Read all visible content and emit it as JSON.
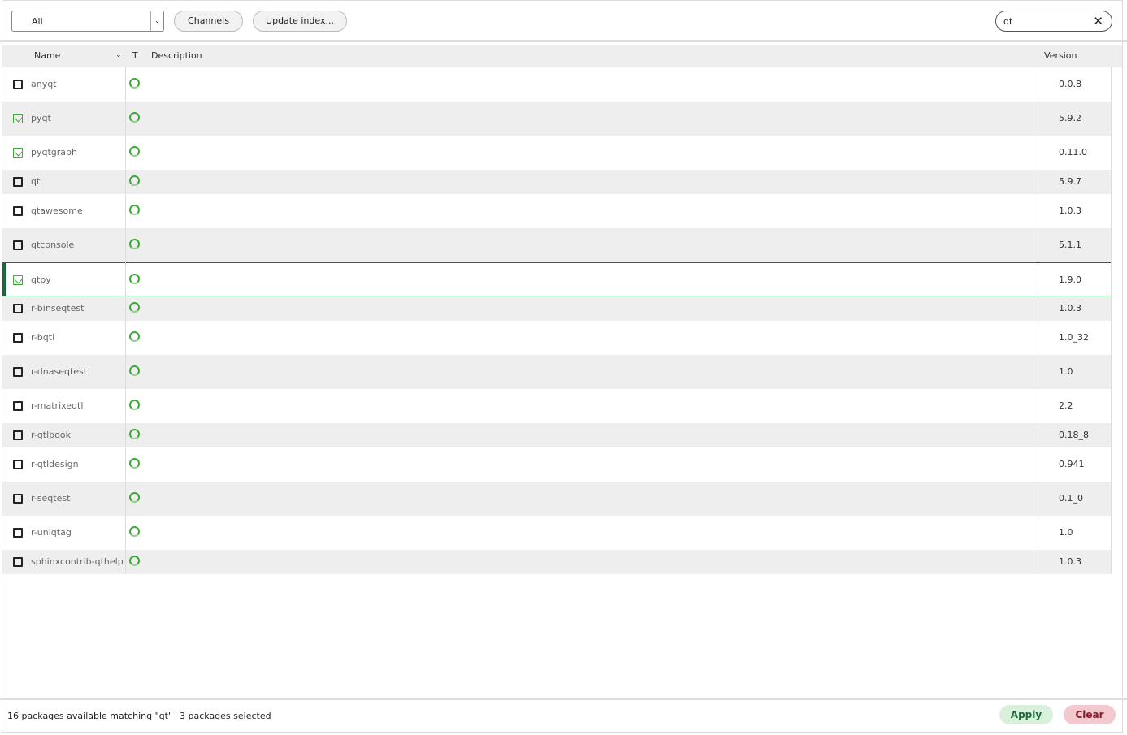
{
  "toolbar": {
    "filter": "All",
    "channels": "Channels",
    "update_index": "Update index...",
    "search_value": "qt"
  },
  "header": {
    "name": "Name",
    "type": "T",
    "description": "Description",
    "version": "Version"
  },
  "packages": [
    {
      "name": "anyqt",
      "version": "0.0.8",
      "installed": false
    },
    {
      "name": "pyqt",
      "version": "5.9.2",
      "installed": true
    },
    {
      "name": "pyqtgraph",
      "version": "0.11.0",
      "installed": true
    },
    {
      "name": "qt",
      "version": "5.9.7",
      "installed": false
    },
    {
      "name": "qtawesome",
      "version": "1.0.3",
      "installed": false
    },
    {
      "name": "qtconsole",
      "version": "5.1.1",
      "installed": false
    },
    {
      "name": "qtpy",
      "version": "1.9.0",
      "installed": true,
      "selected": true
    },
    {
      "name": "r-binseqtest",
      "version": "1.0.3",
      "installed": false
    },
    {
      "name": "r-bqtl",
      "version": "1.0_32",
      "installed": false
    },
    {
      "name": "r-dnaseqtest",
      "version": "1.0",
      "installed": false
    },
    {
      "name": "r-matrixeqtl",
      "version": "2.2",
      "installed": false
    },
    {
      "name": "r-qtlbook",
      "version": "0.18_8",
      "installed": false
    },
    {
      "name": "r-qtldesign",
      "version": "0.941",
      "installed": false
    },
    {
      "name": "r-seqtest",
      "version": "0.1_0",
      "installed": false
    },
    {
      "name": "r-uniqtag",
      "version": "1.0",
      "installed": false
    },
    {
      "name": "sphinxcontrib-qthelp",
      "version": "1.0.3",
      "installed": false
    }
  ],
  "status": {
    "available": "16 packages available matching \"qt\"",
    "selected": "3 packages selected"
  },
  "actions": {
    "apply": "Apply",
    "clear": "Clear"
  },
  "colors": {
    "accent": "#1a6b3a",
    "installed": "#3aaa35",
    "apply_bg": "#d9f0dc",
    "clear_bg": "#f2c9cf"
  }
}
